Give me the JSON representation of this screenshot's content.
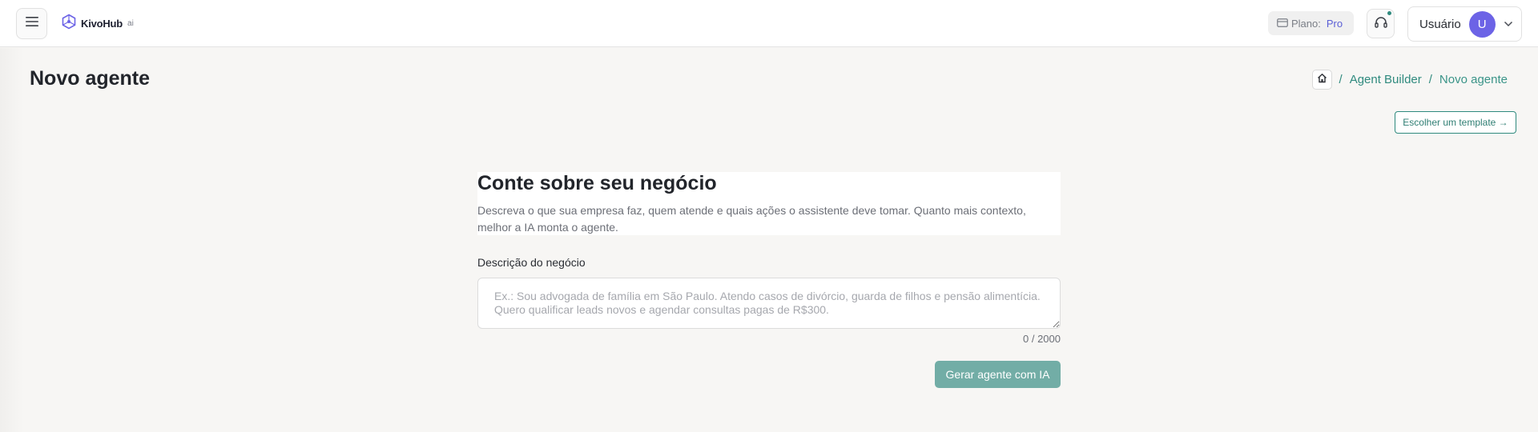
{
  "header": {
    "menu_icon": "hamburger-icon",
    "logo": {
      "name": "KivoHub",
      "suffix": "ai",
      "icon": "hexagon-network-icon"
    },
    "plan": {
      "label": "Plano:",
      "value": "Pro",
      "icon": "card-icon"
    },
    "support": {
      "icon": "headphones-icon",
      "has_notification": true
    },
    "user": {
      "name": "Usuário",
      "initial": "U",
      "chevron": "chevron-down-icon"
    }
  },
  "page": {
    "title": "Novo agente",
    "breadcrumb": {
      "home_icon": "home-icon",
      "separator": "/",
      "items": [
        "Agent Builder",
        "Novo agente"
      ]
    },
    "template_button": "Escolher um template →"
  },
  "form": {
    "title": "Conte sobre seu negócio",
    "description": "Descreva o que sua empresa faz, quem atende e quais ações o assistente deve tomar. Quanto mais contexto, melhor a IA monta o agente.",
    "field_label": "Descrição do negócio",
    "value": "",
    "placeholder": "Ex.: Sou advogada de família em São Paulo. Atendo casos de divórcio, guarda de filhos e pensão alimentícia. Quero qualificar leads novos e agendar consultas pagas de R$300.",
    "char_count": "0 / 2000",
    "submit_label": "Gerar agente com IA"
  },
  "colors": {
    "accent": "#2f8a7e",
    "button_disabled": "#72ada6",
    "avatar": "#6c63e6",
    "plan_value": "#5b5fd6",
    "background": "#f7f6f4"
  }
}
